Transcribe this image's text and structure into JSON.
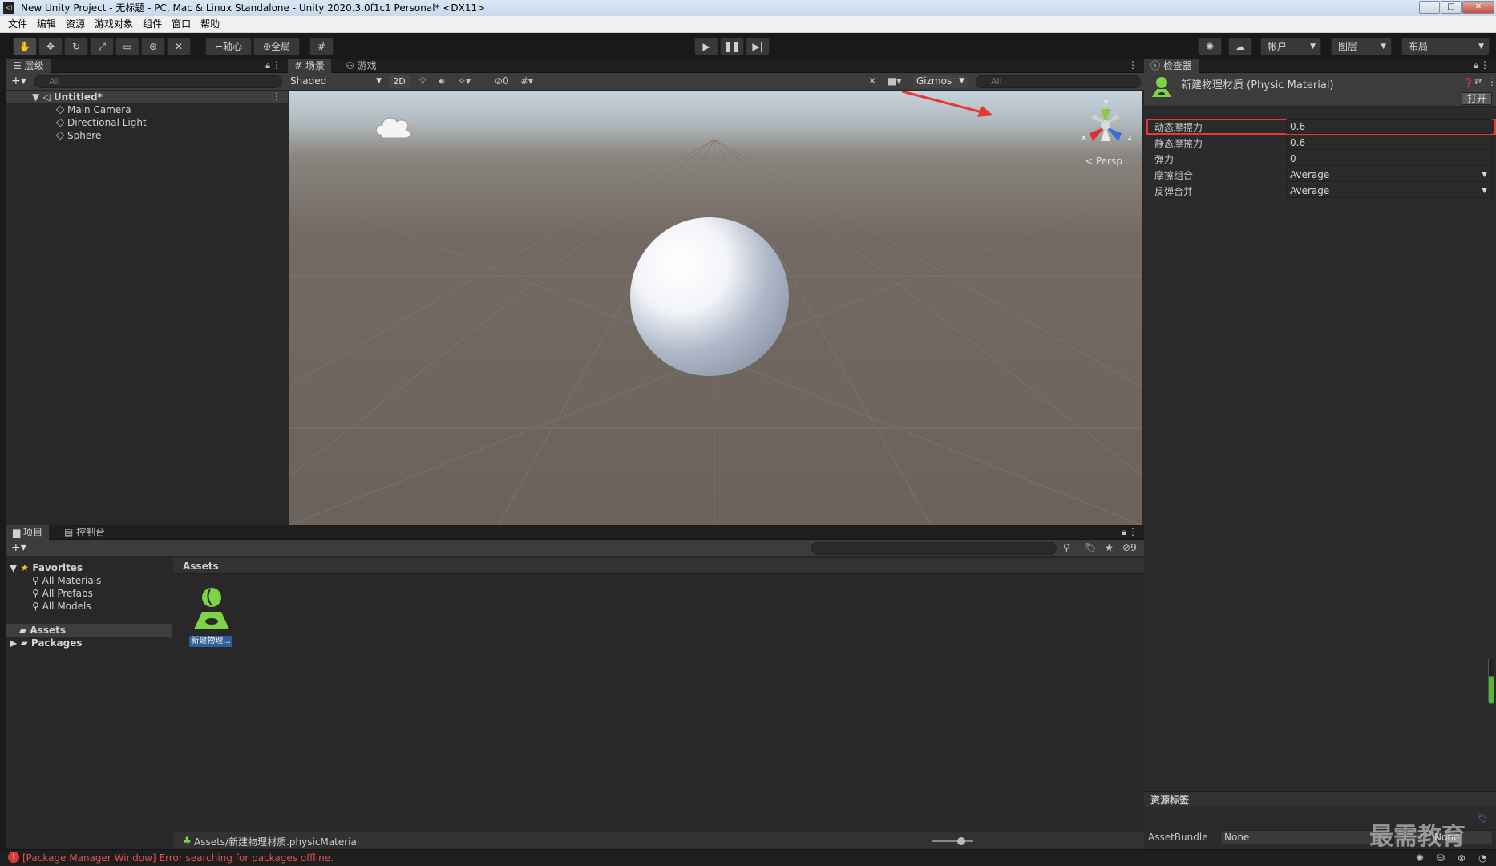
{
  "window": {
    "title": "New Unity Project - 无标题 - PC, Mac & Linux Standalone - Unity 2020.3.0f1c1 Personal* <DX11>",
    "min": "─",
    "max": "□",
    "close": "✕"
  },
  "menu": [
    "文件",
    "编辑",
    "资源",
    "游戏对象",
    "组件",
    "窗口",
    "帮助"
  ],
  "toolbar": {
    "pivot": "轴心",
    "global": "全局",
    "account": "帐户",
    "layers": "图层",
    "layout": "布局"
  },
  "hierarchy": {
    "tab": "层级",
    "search_placeholder": "All",
    "scene": "Untitled*",
    "items": [
      "Main Camera",
      "Directional Light",
      "Sphere"
    ]
  },
  "scene": {
    "tab_scene": "场景",
    "tab_game": "游戏",
    "shading": "Shaded",
    "mode_2d": "2D",
    "hidden_count": "0",
    "gizmos": "Gizmos",
    "search_placeholder": "All",
    "persp": "< Persp",
    "axis_x": "x",
    "axis_y": "y",
    "axis_z": "z"
  },
  "inspector": {
    "tab": "检查器",
    "title": "新建物理材质 (Physic Material)",
    "open_button": "打开",
    "props": [
      {
        "label": "动态摩擦力",
        "value": "0.6"
      },
      {
        "label": "静态摩擦力",
        "value": "0.6"
      },
      {
        "label": "弹力",
        "value": "0"
      },
      {
        "label": "摩擦组合",
        "value": "Average"
      },
      {
        "label": "反弹合并",
        "value": "Average"
      }
    ],
    "asset_labels": "资源标签",
    "asset_bundle_label": "AssetBundle",
    "asset_bundle_value": "None",
    "asset_bundle_variant": "None"
  },
  "project": {
    "tab_project": "项目",
    "tab_console": "控制台",
    "favorites": "Favorites",
    "fav_items": [
      "All Materials",
      "All Prefabs",
      "All Models"
    ],
    "assets": "Assets",
    "packages": "Packages",
    "breadcrumb": "Assets",
    "asset_name": "新建物理...",
    "hidden_count": "9",
    "path": "Assets/新建物理材质.physicMaterial"
  },
  "status": {
    "error": "[Package Manager Window] Error searching for packages offline."
  },
  "watermark": "最需教育",
  "colors": {
    "accent": "#3a72b0",
    "highlight_box": "#e53935",
    "error": "#e05252",
    "asset_green": "#7ed348"
  }
}
